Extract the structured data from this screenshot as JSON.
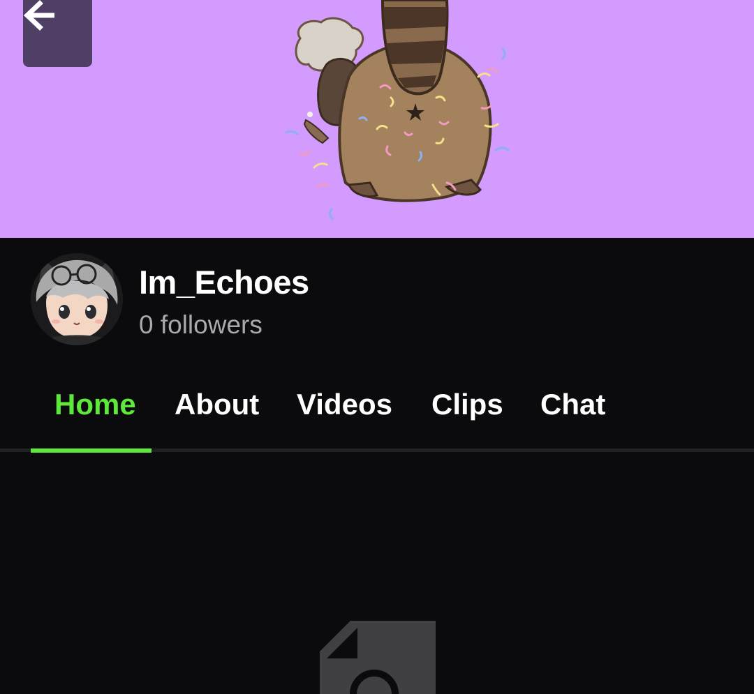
{
  "banner": {
    "background_color": "#d29bfd",
    "image": "raccoon-confetti-illustration"
  },
  "back_button": {
    "icon": "arrow-left-icon",
    "background_color": "#4f3f65"
  },
  "profile": {
    "name": "Im_Echoes",
    "followers": "0 followers",
    "avatar": "anime-avatar-with-glasses"
  },
  "tabs": [
    {
      "label": "Home",
      "active": true
    },
    {
      "label": "About",
      "active": false
    },
    {
      "label": "Videos",
      "active": false
    },
    {
      "label": "Clips",
      "active": false
    },
    {
      "label": "Chat",
      "active": false
    }
  ],
  "colors": {
    "accent": "#5ce93a",
    "page_background": "#0b0b0d",
    "secondary_text": "#a9a9b0"
  },
  "content": {
    "icon": "document-search-icon"
  }
}
